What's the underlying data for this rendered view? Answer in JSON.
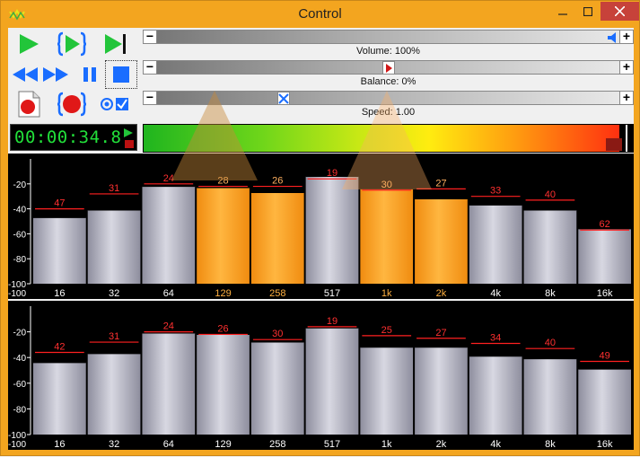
{
  "window": {
    "title": "Control"
  },
  "volume": {
    "label": "Volume: 100%",
    "percent": 100
  },
  "balance": {
    "label": "Balance: 0%",
    "percent": 0
  },
  "speed": {
    "label": "Speed: 1.00",
    "value": 1.0
  },
  "time": {
    "display": "00:00:34.8"
  },
  "level": {
    "fill_fraction": 0.99
  },
  "colors": {
    "accent": "#f3a51f",
    "bar_orange": "#ffa51e",
    "bar_gray": "#a9a9b5",
    "peak_red": "#ff2020",
    "time_green": "#22e03a"
  },
  "icons": [
    "play-icon",
    "loop-play-icon",
    "play-to-end-icon",
    "rewind-icon",
    "fast-forward-icon",
    "pause-icon",
    "stop-icon",
    "new-file-icon",
    "record-icon",
    "loop-record-icon",
    "options-check-icon",
    "speaker-icon"
  ],
  "chart_data": [
    {
      "type": "bar",
      "categories": [
        "16",
        "32",
        "64",
        "129",
        "258",
        "517",
        "1k",
        "2k",
        "4k",
        "8k",
        "16k"
      ],
      "y_ticks": [
        "-20",
        "-40",
        "-60",
        "-80",
        "-100"
      ],
      "ylim": [
        -100,
        0
      ],
      "series": [
        {
          "values": [
            -47,
            -41,
            -22,
            -23,
            -27,
            -14,
            -24,
            -32,
            -37,
            -41,
            -56
          ]
        }
      ],
      "peak_labels": [
        "47",
        "31",
        "24",
        "28",
        "26",
        "19",
        "30",
        "27",
        "33",
        "40",
        "62"
      ],
      "peaks": [
        -40,
        -28,
        -20,
        -22,
        -22,
        -16,
        -25,
        -24,
        -30,
        -33,
        -57
      ],
      "highlight": [
        false,
        false,
        false,
        true,
        true,
        false,
        true,
        true,
        false,
        false,
        false
      ]
    },
    {
      "type": "bar",
      "categories": [
        "16",
        "32",
        "64",
        "129",
        "258",
        "517",
        "1k",
        "2k",
        "4k",
        "8k",
        "16k"
      ],
      "y_ticks": [
        "-20",
        "-40",
        "-60",
        "-80",
        "-100"
      ],
      "ylim": [
        -100,
        0
      ],
      "series": [
        {
          "values": [
            -44,
            -37,
            -21,
            -22,
            -28,
            -17,
            -32,
            -32,
            -39,
            -41,
            -49
          ]
        }
      ],
      "peak_labels": [
        "42",
        "31",
        "24",
        "26",
        "30",
        "19",
        "25",
        "27",
        "34",
        "40",
        "49"
      ],
      "peaks": [
        -36,
        -28,
        -20,
        -22,
        -26,
        -16,
        -23,
        -25,
        -29,
        -33,
        -43
      ],
      "highlight": [
        false,
        false,
        false,
        false,
        false,
        false,
        false,
        false,
        false,
        false,
        false
      ]
    }
  ]
}
